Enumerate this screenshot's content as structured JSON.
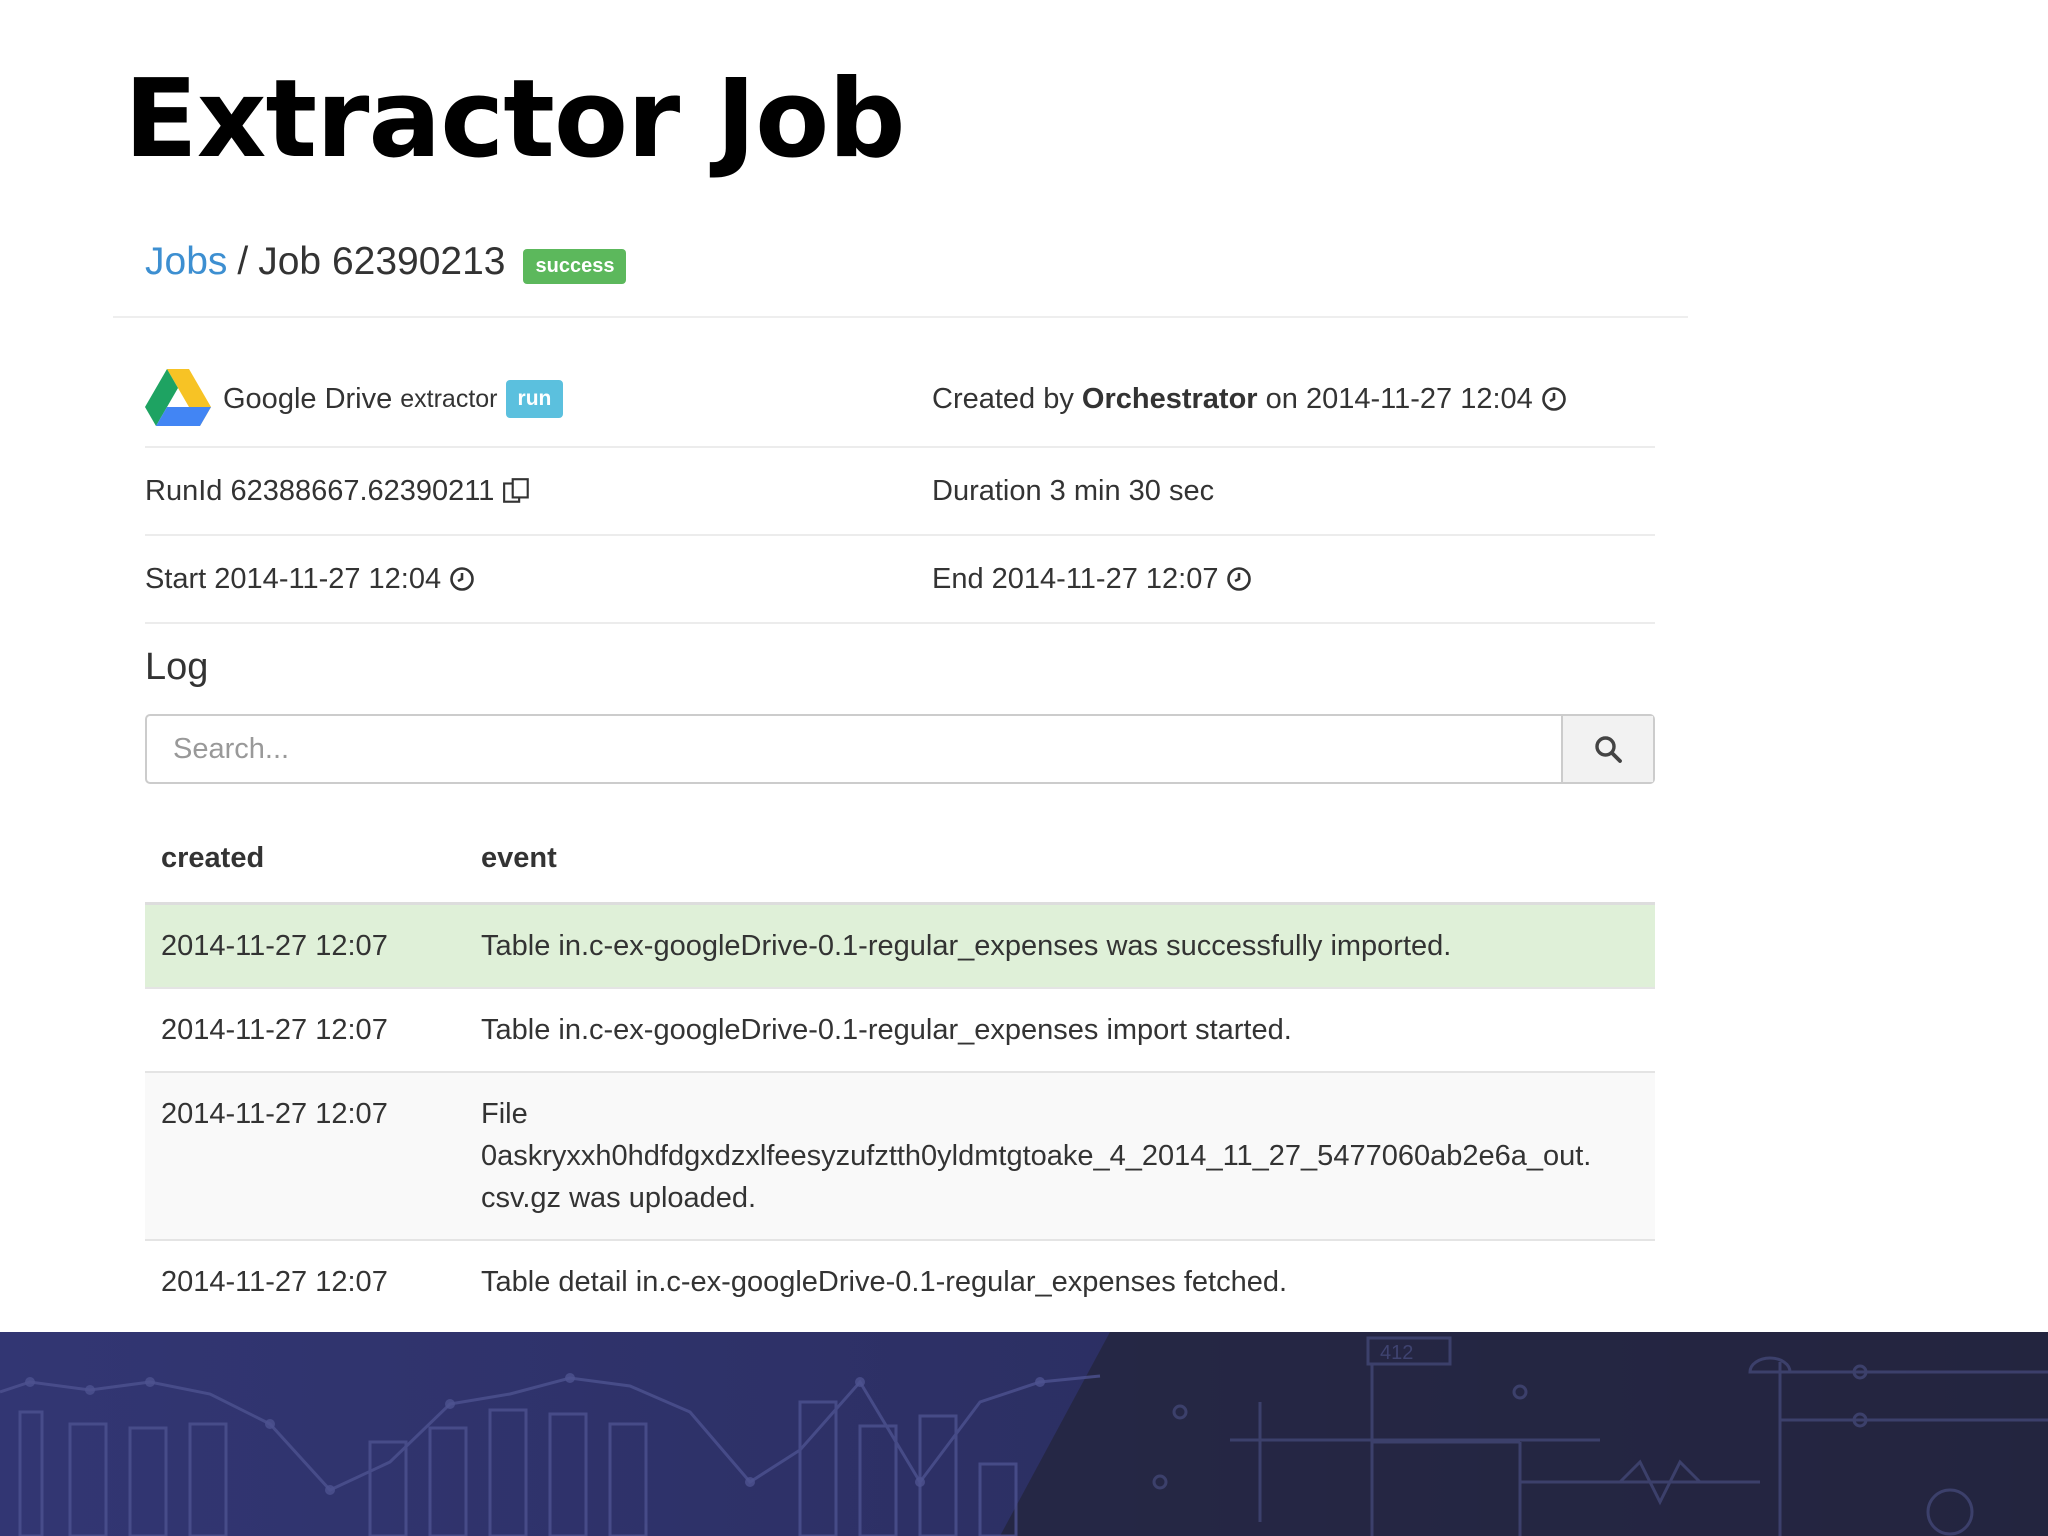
{
  "slide": {
    "title": "Extractor Job"
  },
  "breadcrumb": {
    "jobs_link": "Jobs",
    "separator": "/",
    "job_label": "Job 62390213",
    "status_badge": "success"
  },
  "colors": {
    "success_badge": "#5cb85c",
    "run_badge": "#5bc0de",
    "link": "#3d8fd1",
    "success_row": "#dff0d8",
    "footer": "#2a2d5c"
  },
  "info": {
    "component_name": "Google Drive",
    "component_type": "extractor",
    "run_badge": "run",
    "created_by_prefix": "Created by",
    "created_by": "Orchestrator",
    "created_on": "on 2014-11-27 12:04",
    "run_id": "RunId 62388667.62390211",
    "duration": "Duration 3 min 30 sec",
    "start": "Start 2014-11-27 12:04",
    "end": "End 2014-11-27 12:07"
  },
  "icons": {
    "logo": "google-drive-logo",
    "clock": "clock-icon",
    "copy": "copy-icon",
    "search": "search-icon"
  },
  "log": {
    "heading": "Log",
    "search_placeholder": "Search...",
    "columns": [
      "created",
      "event"
    ],
    "rows": [
      {
        "created": "2014-11-27 12:07",
        "event": "Table in.c-ex-googleDrive-0.1-regular_expenses was successfully imported."
      },
      {
        "created": "2014-11-27 12:07",
        "event": "Table in.c-ex-googleDrive-0.1-regular_expenses import started."
      },
      {
        "created": "2014-11-27 12:07",
        "event_line1": "File",
        "event_line2": "0askryxxh0hdfdgxdzxlfeesyzufztth0yldmtgtoake_4_2014_11_27_5477060ab2e6a_out.",
        "event_line3": "csv.gz was uploaded."
      },
      {
        "created": "2014-11-27 12:07",
        "event": "Table detail in.c-ex-googleDrive-0.1-regular_expenses fetched."
      }
    ]
  },
  "footer": {
    "sign_text": "412"
  }
}
